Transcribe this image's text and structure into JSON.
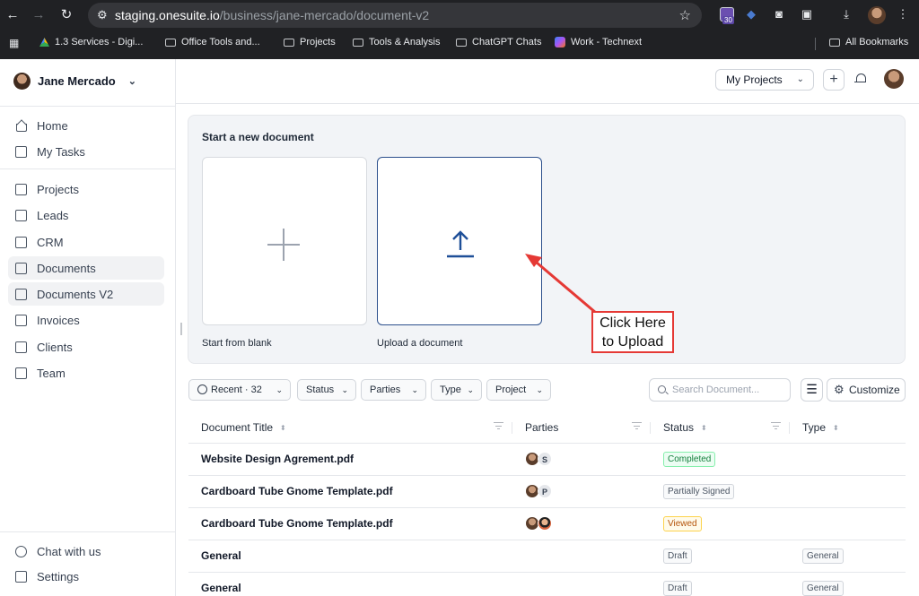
{
  "browser": {
    "url_host": "staging.onesuite.io",
    "url_path": "/business/jane-mercado/document-v2",
    "extension_count": "30",
    "bookmarks": [
      {
        "icon": "google-drive-icon",
        "label": "1.3 Services - Digi..."
      },
      {
        "icon": "folder-icon",
        "label": "Office Tools and..."
      },
      {
        "icon": "folder-icon",
        "label": "Projects"
      },
      {
        "icon": "folder-icon",
        "label": "Tools & Analysis"
      },
      {
        "icon": "folder-icon",
        "label": "ChatGPT Chats"
      },
      {
        "icon": "copilot-icon",
        "label": "Work - Technext"
      }
    ],
    "all_bookmarks": "All Bookmarks"
  },
  "sidebar": {
    "user_name": "Jane Mercado",
    "items": [
      {
        "icon": "home-icon",
        "label": "Home"
      },
      {
        "icon": "clipboard-icon",
        "label": "My Tasks"
      },
      {
        "icon": "projects-icon",
        "label": "Projects"
      },
      {
        "icon": "leads-icon",
        "label": "Leads"
      },
      {
        "icon": "crm-icon",
        "label": "CRM"
      },
      {
        "icon": "documents-icon",
        "label": "Documents"
      },
      {
        "icon": "documents-v2-icon",
        "label": "Documents V2"
      },
      {
        "icon": "invoice-icon",
        "label": "Invoices"
      },
      {
        "icon": "clients-icon",
        "label": "Clients"
      },
      {
        "icon": "team-icon",
        "label": "Team"
      }
    ],
    "chat_label": "Chat with us",
    "settings_label": "Settings"
  },
  "topbar": {
    "projects_dropdown": "My Projects"
  },
  "start_panel": {
    "title": "Start a new document",
    "blank_label": "Start from blank",
    "upload_label": "Upload a document"
  },
  "annotation": {
    "line1": "Click Here",
    "line2": "to Upload",
    "color": "#e53935"
  },
  "filters": {
    "recent": "Recent · 32",
    "status": "Status",
    "parties": "Parties",
    "type": "Type",
    "project": "Project",
    "search_placeholder": "Search Document...",
    "customize": "Customize"
  },
  "table": {
    "columns": [
      "Document Title",
      "Parties",
      "Status",
      "Type"
    ],
    "rows": [
      {
        "title": "Website Design Agrement.pdf",
        "party_letter": "S",
        "status": "Completed",
        "type": ""
      },
      {
        "title": "Cardboard Tube Gnome Template.pdf",
        "party_letter": "P",
        "status": "Partially Signed",
        "type": ""
      },
      {
        "title": "Cardboard Tube Gnome Template.pdf",
        "party_letter": "",
        "status": "Viewed",
        "type": ""
      },
      {
        "title": "General",
        "party_letter": "",
        "status": "Draft",
        "type": "General"
      },
      {
        "title": "General",
        "party_letter": "",
        "status": "Draft",
        "type": "General"
      }
    ]
  }
}
